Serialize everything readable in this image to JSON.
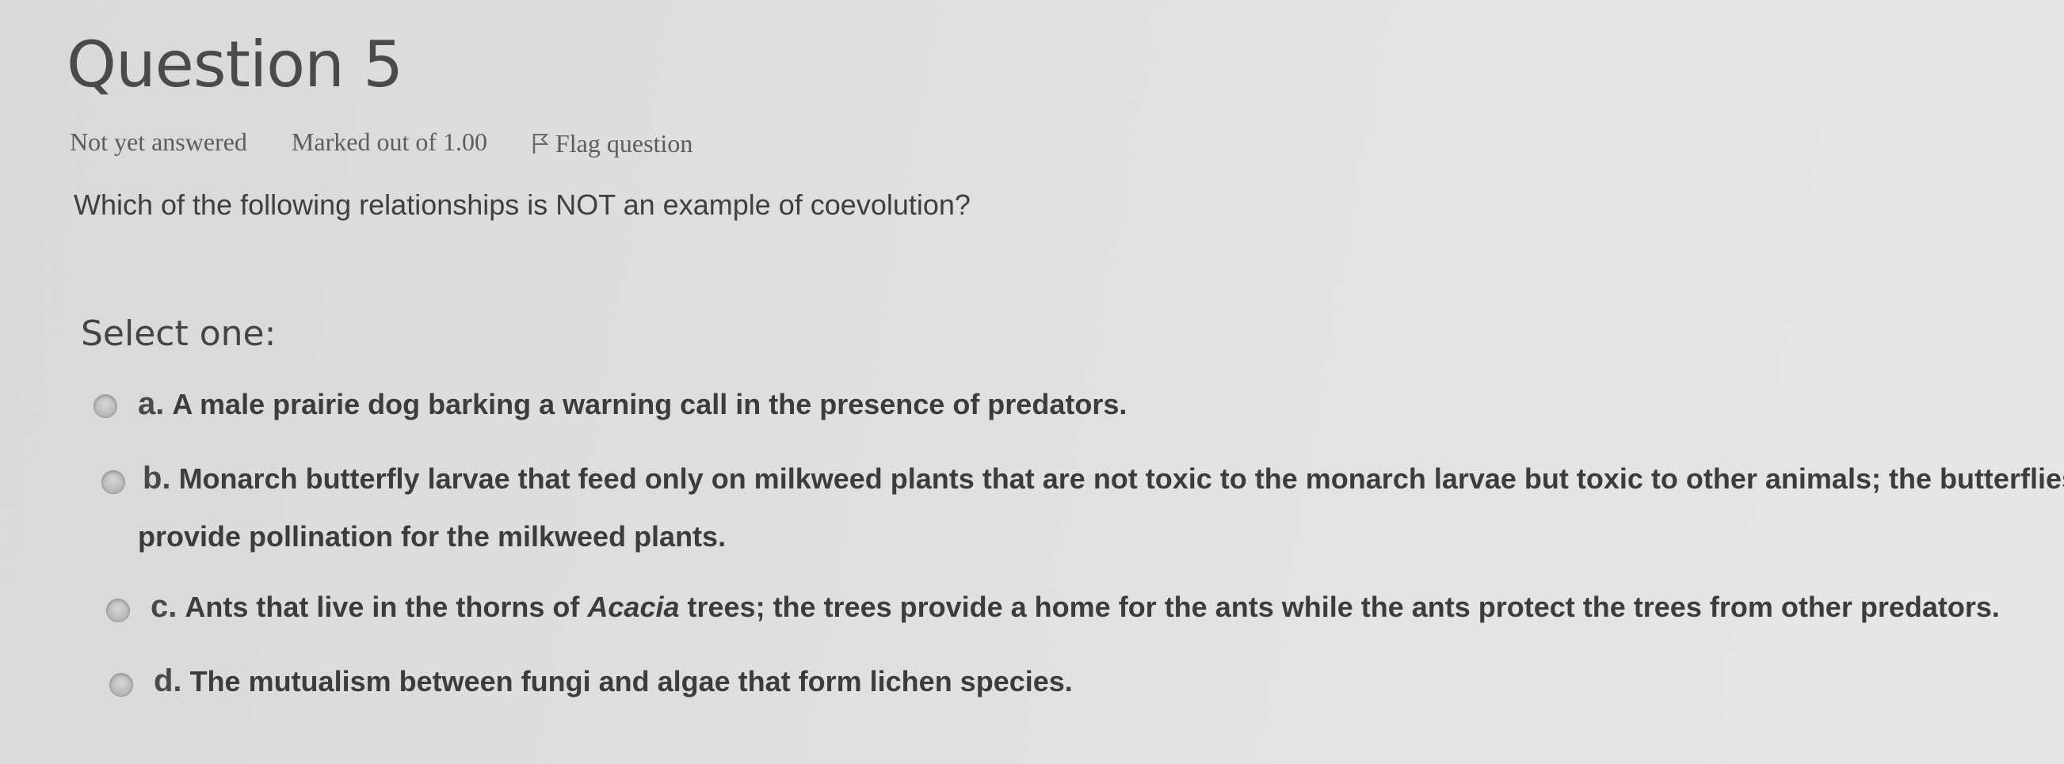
{
  "question": {
    "title": "Question 5",
    "status": "Not yet answered",
    "marked": "Marked out of 1.00",
    "flag_label": "Flag question",
    "text": "Which of the following relationships is NOT an example of coevolution?",
    "select_prompt": "Select one:"
  },
  "options": [
    {
      "letter": "a.",
      "text": "A male prairie dog barking a warning call in the presence of predators."
    },
    {
      "letter": "b.",
      "text": "Monarch butterfly larvae that feed only on milkweed plants that are not toxic to the monarch larvae but toxic to other animals; the butterflies",
      "text_line2": "provide pollination for the milkweed plants."
    },
    {
      "letter": "c.",
      "text_before": "Ants that live in the thorns of",
      "text_italic": "Acacia",
      "text_after": "trees; the trees provide a home for the ants while the ants protect the trees from other predators."
    },
    {
      "letter": "d.",
      "text": "The mutualism between fungi and algae that form lichen species."
    }
  ],
  "icons": {
    "flag": "flag-icon",
    "radio": "radio-unselected-icon"
  }
}
